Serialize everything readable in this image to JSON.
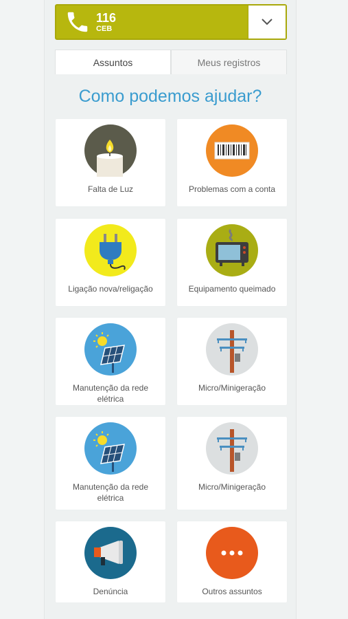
{
  "call": {
    "number": "116",
    "provider": "CEB"
  },
  "tabs": {
    "subjects": "Assuntos",
    "records": "Meus registros"
  },
  "heading": "Como podemos ajudar?",
  "cards": [
    {
      "label": "Falta de Luz",
      "icon": "candle-icon"
    },
    {
      "label": "Problemas com a conta",
      "icon": "barcode-icon"
    },
    {
      "label": "Ligação nova/religação",
      "icon": "plug-icon"
    },
    {
      "label": "Equipamento queimado",
      "icon": "burnt-tv-icon"
    },
    {
      "label": "Manutenção da rede elétrica",
      "icon": "solar-panel-icon"
    },
    {
      "label": "Micro/Minigeração",
      "icon": "power-pole-icon"
    },
    {
      "label": "Manutenção da rede elétrica",
      "icon": "solar-panel-icon"
    },
    {
      "label": "Micro/Minigeração",
      "icon": "power-pole-icon"
    },
    {
      "label": "Denúncia",
      "icon": "megaphone-icon"
    },
    {
      "label": "Outros assuntos",
      "icon": "more-icon"
    }
  ],
  "colors": {
    "callbar": "#b7b70e",
    "heading": "#3a9ccf",
    "candle_bg": "#5b5b4b",
    "barcode_bg": "#f08a24",
    "plug_bg": "#f2ea1c",
    "tv_bg": "#a9ad14",
    "solar_bg": "#4aa3d9",
    "pole_bg": "#dcdfe0",
    "megaphone_bg": "#1b6a8d",
    "more_bg": "#e85a1c"
  }
}
